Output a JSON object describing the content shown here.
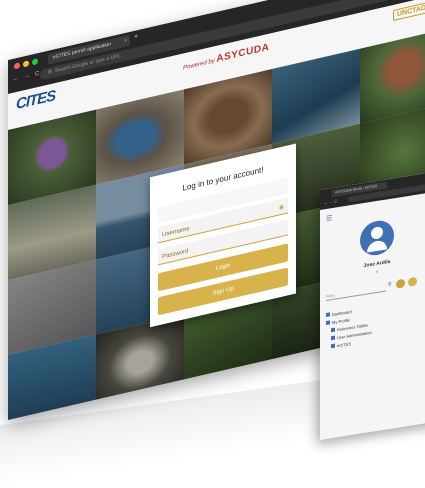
{
  "main_window": {
    "tab_title": "eCITES permit application",
    "tab_close": "×",
    "new_tab": "+",
    "address_placeholder": "Search Google or type a URL",
    "powered_by_prefix": "Powered by",
    "powered_by_brand": "ASYCUDA",
    "unctad_logo": "UNCTAD",
    "cites_logo": "CITES",
    "login": {
      "title": "Log in to your account!",
      "username_placeholder": "Username",
      "password_placeholder": "Password",
      "login_label": "Login",
      "signup_label": "Sign Up"
    }
  },
  "second_window": {
    "tab_title": "ASYCUDA World - eCITES",
    "user_name": "Jose Ardila",
    "user_id": "#",
    "search_placeholder": "Filter",
    "menu_items": [
      {
        "label": "Dashboard",
        "sub": false
      },
      {
        "label": "My Profile",
        "sub": false
      },
      {
        "label": "Reference Tables",
        "sub": true
      },
      {
        "label": "User Administration",
        "sub": true
      },
      {
        "label": "eCITES",
        "sub": true
      }
    ]
  },
  "colors": {
    "accent_gold": "#d8b24a",
    "brand_blue": "#3f6fb5",
    "chrome_dark": "#262626"
  },
  "icons": [
    "search-icon",
    "eye-icon",
    "menu-icon",
    "avatar-icon",
    "reload-icon",
    "back-icon",
    "forward-icon"
  ]
}
